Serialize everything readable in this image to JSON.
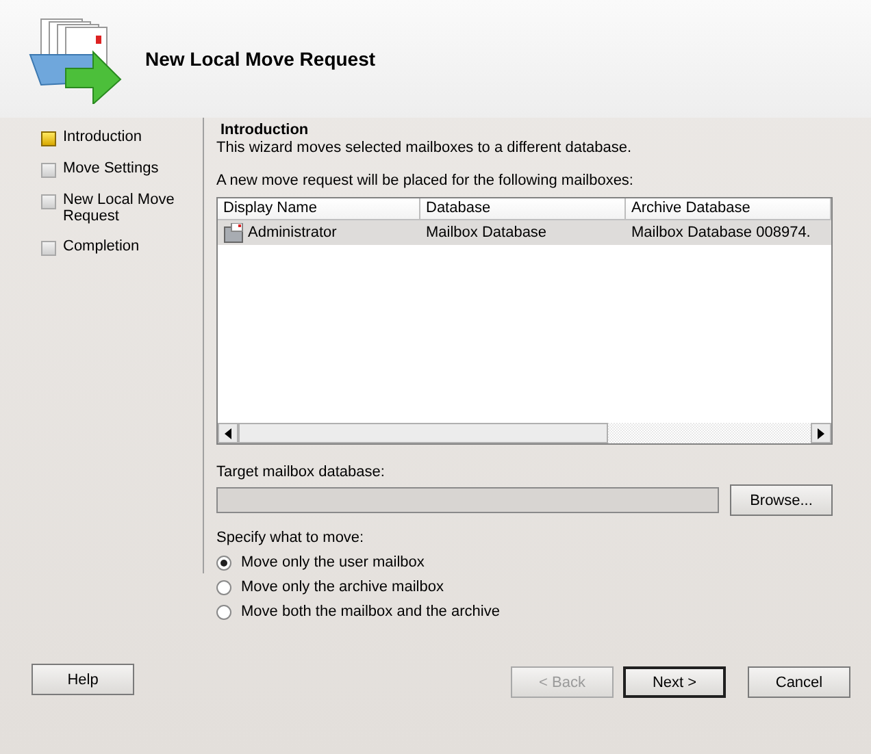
{
  "header": {
    "title": "New Local Move Request"
  },
  "steps": [
    {
      "label": "Introduction",
      "selected": true
    },
    {
      "label": "Move Settings",
      "selected": false
    },
    {
      "label": "New Local Move Request",
      "selected": false
    },
    {
      "label": "Completion",
      "selected": false
    }
  ],
  "page": {
    "heading": "Introduction",
    "description": "This wizard moves selected mailboxes to a different database.",
    "list_label": "A new move request will be placed for the following mailboxes:"
  },
  "table": {
    "columns": [
      "Display Name",
      "Database",
      "Archive Database"
    ],
    "rows": [
      {
        "cells": [
          "Administrator",
          "Mailbox Database",
          "Mailbox Database 008974."
        ],
        "selected": true
      }
    ]
  },
  "target": {
    "label": "Target mailbox database:",
    "browse": "Browse..."
  },
  "move_options": {
    "label": "Specify what to move:",
    "options": [
      {
        "label": "Move only the user mailbox",
        "selected": true
      },
      {
        "label": "Move only the archive mailbox",
        "selected": false
      },
      {
        "label": "Move both the mailbox and the archive",
        "selected": false
      }
    ]
  },
  "buttons": {
    "help": "Help",
    "nav": [
      {
        "label": "< Back",
        "disabled": true,
        "default": false
      },
      {
        "label": "Next >",
        "disabled": false,
        "default": true
      },
      {
        "label": "Cancel",
        "disabled": false,
        "default": false
      }
    ]
  }
}
